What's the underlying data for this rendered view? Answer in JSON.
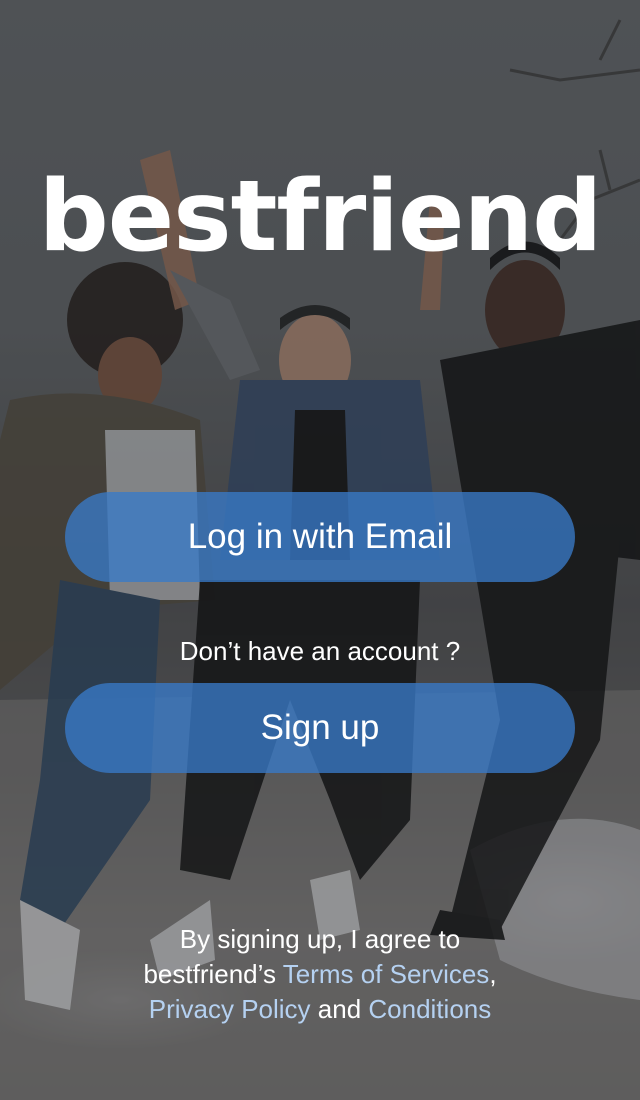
{
  "app": {
    "logo_text": "bestfriend"
  },
  "login": {
    "email_button_label": "Log in with Email"
  },
  "signup": {
    "prompt_text": "Don’t have an account ?",
    "button_label": "Sign up"
  },
  "legal": {
    "intro": "By signing up, I agree to bestfriend’s ",
    "terms_link": "Terms of Services",
    "comma": ", ",
    "privacy_link": "Privacy Policy",
    "and_text": " and ",
    "conditions_link": "Conditions"
  },
  "theme": {
    "button_color": "#387AC8",
    "link_color": "#B5D1F1",
    "text_color": "#FFFFFF"
  },
  "background": {
    "icon": "photo-friends-jumping-in-snow"
  }
}
